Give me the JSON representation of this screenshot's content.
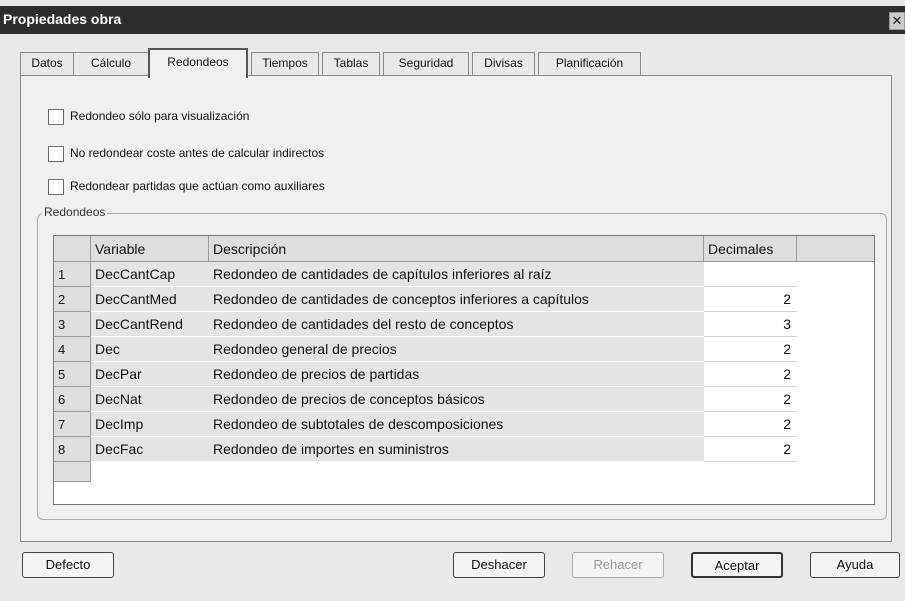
{
  "window": {
    "title": "Propiedades obra"
  },
  "tabs": [
    "Datos",
    "Cálculo",
    "Redondeos",
    "Tiempos",
    "Tablas",
    "Seguridad",
    "Divisas",
    "Planificación"
  ],
  "active_tab": "Redondeos",
  "checkboxes": [
    {
      "label": "Redondeo sólo para visualización",
      "checked": false
    },
    {
      "label": "No redondear coste antes de calcular indirectos",
      "checked": false
    },
    {
      "label": "Redondear partidas que actúan como auxiliares",
      "checked": false
    }
  ],
  "group": {
    "label": "Redondeos"
  },
  "grid": {
    "headers": [
      "Variable",
      "Descripción",
      "Decimales"
    ],
    "rows": [
      {
        "n": "1",
        "variable": "DecCantCap",
        "descripcion": "Redondeo de cantidades de capítulos inferiores al raíz",
        "decimales": ""
      },
      {
        "n": "2",
        "variable": "DecCantMed",
        "descripcion": "Redondeo de cantidades de conceptos inferiores a capítulos",
        "decimales": "2"
      },
      {
        "n": "3",
        "variable": "DecCantRend",
        "descripcion": "Redondeo de cantidades del resto de conceptos",
        "decimales": "3"
      },
      {
        "n": "4",
        "variable": "Dec",
        "descripcion": "Redondeo general de precios",
        "decimales": "2"
      },
      {
        "n": "5",
        "variable": "DecPar",
        "descripcion": "Redondeo de precios de partidas",
        "decimales": "2"
      },
      {
        "n": "6",
        "variable": "DecNat",
        "descripcion": "Redondeo de precios de conceptos básicos",
        "decimales": "2"
      },
      {
        "n": "7",
        "variable": "DecImp",
        "descripcion": "Redondeo de subtotales de descomposiciones",
        "decimales": "2"
      },
      {
        "n": "8",
        "variable": "DecFac",
        "descripcion": "Redondeo de importes en suministros",
        "decimales": "2"
      }
    ]
  },
  "buttons": {
    "defecto": "Defecto",
    "deshacer": "Deshacer",
    "rehacer": "Rehacer",
    "aceptar": "Aceptar",
    "ayuda": "Ayuda"
  }
}
